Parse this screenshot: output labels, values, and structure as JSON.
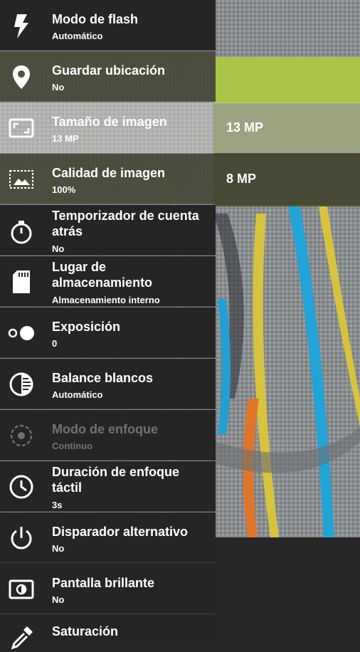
{
  "settings": [
    {
      "title": "Modo de flash",
      "subtitle": "Automático",
      "icon": "flash-icon"
    },
    {
      "title": "Guardar ubicación",
      "subtitle": "No",
      "icon": "location-pin-icon"
    },
    {
      "title": "Tamaño de imagen",
      "subtitle": "13 MP",
      "icon": "image-size-icon"
    },
    {
      "title": "Calidad de imagen",
      "subtitle": "100%",
      "icon": "image-quality-icon"
    },
    {
      "title": "Temporizador de cuenta atrás",
      "subtitle": "No",
      "icon": "timer-icon"
    },
    {
      "title": "Lugar de almacenamiento",
      "subtitle": "Almacenamiento interno",
      "icon": "sd-card-icon"
    },
    {
      "title": "Exposición",
      "subtitle": "0",
      "icon": "exposure-icon"
    },
    {
      "title": "Balance blancos",
      "subtitle": "Automático",
      "icon": "white-balance-icon"
    },
    {
      "title": "Modo de enfoque",
      "subtitle": "Continuo",
      "icon": "focus-icon",
      "disabled": true
    },
    {
      "title": "Duración de enfoque táctil",
      "subtitle": "3s",
      "icon": "clock-icon"
    },
    {
      "title": "Disparador alternativo",
      "subtitle": "No",
      "icon": "power-icon"
    },
    {
      "title": "Pantalla brillante",
      "subtitle": "No",
      "icon": "brightness-icon"
    },
    {
      "title": "Saturación",
      "subtitle": "",
      "icon": "eyedropper-icon"
    }
  ],
  "size_options": [
    {
      "label": "13 MP"
    },
    {
      "label": "8 MP"
    }
  ]
}
